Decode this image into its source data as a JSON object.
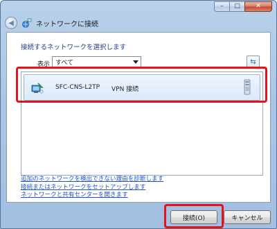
{
  "window": {
    "title": "ネットワークに接続",
    "controls": {
      "minimize": "–",
      "maximize": "□",
      "close": "✕"
    }
  },
  "nav": {
    "back_glyph": "◀"
  },
  "panel": {
    "instruction": "接続するネットワークを選択します",
    "filter": {
      "label": "表示",
      "selected": "すべて"
    },
    "refresh_glyph": "⇆",
    "networks": [
      {
        "name": "SFC-CNS-L2TP",
        "type": "VPN 接続"
      }
    ],
    "links": [
      "追加のネットワークを検出できない理由を診断します",
      "接続またはネットワークをセットアップします",
      "ネットワークと共有センターを開きます"
    ]
  },
  "buttons": {
    "connect": "接続(O)",
    "cancel": "キャンセル"
  },
  "colors": {
    "highlight": "#e4131b",
    "link": "#1f53c5",
    "instruction": "#1e3b8a"
  },
  "icons": {
    "back": "back-arrow-icon",
    "app": "network-connection-icon",
    "refresh": "refresh-icon",
    "vpn": "vpn-connection-icon",
    "server": "server-icon"
  }
}
